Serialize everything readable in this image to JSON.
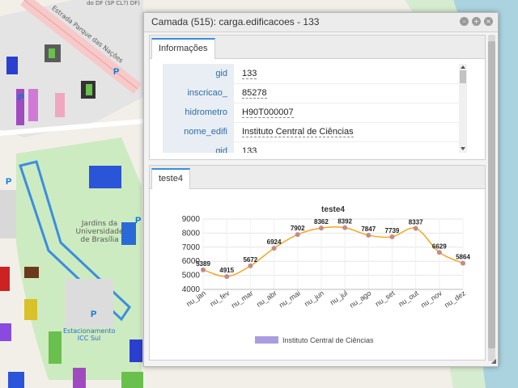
{
  "map": {
    "labels": {
      "street": "Estrada Parque das Nações",
      "campus": "Jardins da Universidade de Brasília",
      "lot": "Estacionamento ICC Sul",
      "top_fragment": "do DF (SP CL?) DF)",
      "parking": "P"
    }
  },
  "dialog": {
    "title": "Camada (515): carga.edificacoes - 133",
    "controls": {
      "minimize": "–",
      "maximize": "+",
      "close": "×"
    }
  },
  "info_panel": {
    "tab": "Informações",
    "rows": [
      {
        "key": "gid",
        "value": "133"
      },
      {
        "key": "inscricao_",
        "value": "85278"
      },
      {
        "key": "hidrometro",
        "value": "H90T000007"
      },
      {
        "key": "nome_edifi",
        "value": "Instituto Central de Ciências"
      },
      {
        "key": "gid",
        "value": "133"
      }
    ]
  },
  "chart_panel": {
    "tab": "teste4"
  },
  "chart_data": {
    "type": "line",
    "title": "teste4",
    "categories": [
      "nu_jan",
      "nu_fev",
      "nu_mar",
      "nu_abr",
      "nu_mai",
      "nu_jun",
      "nu_jul",
      "nu_ago",
      "nu_set",
      "nu_out",
      "nu_nov",
      "nu_dez"
    ],
    "series": [
      {
        "name": "Instituto Central de Ciências",
        "values": [
          5389,
          4915,
          5672,
          6924,
          7902,
          8362,
          8392,
          7847,
          7739,
          8337,
          6629,
          5864
        ]
      }
    ],
    "ylim": [
      4000,
      9000
    ],
    "yticks": [
      4000,
      5000,
      6000,
      7000,
      8000,
      9000
    ],
    "grid": true,
    "legend": "bottom",
    "colors": {
      "line": "#f5a623",
      "point": "#c48a8a",
      "legend_swatch": "#a99de0"
    }
  }
}
